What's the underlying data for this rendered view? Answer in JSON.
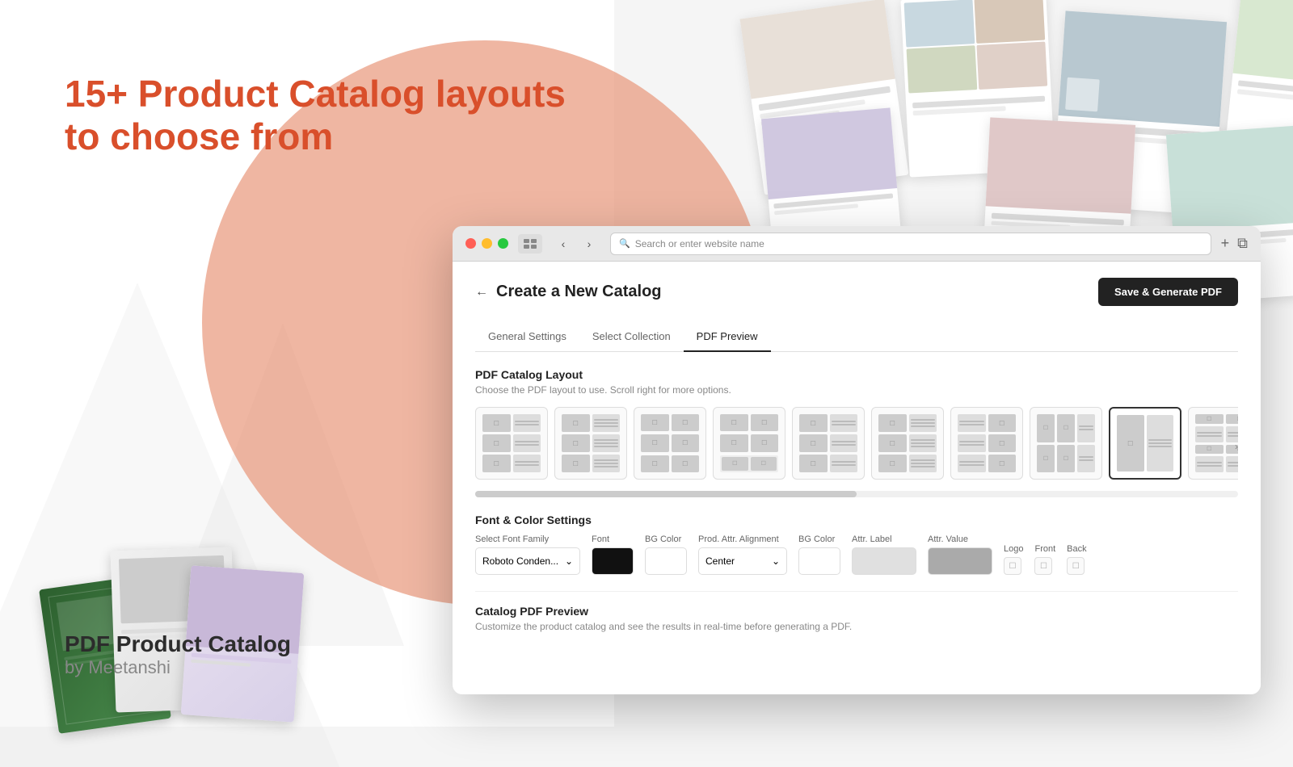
{
  "page": {
    "background": "#f5f5f5"
  },
  "left_panel": {
    "headline_line1": "15+ Product Catalog layouts",
    "headline_line2": "to choose from",
    "brand_title": "PDF Product Catalog",
    "brand_sub": "by Meetanshi"
  },
  "browser": {
    "address_placeholder": "Search or enter website name",
    "title": "Create a New Catalog",
    "save_button": "Save & Generate PDF",
    "back_arrow": "←",
    "tabs": [
      {
        "label": "General Settings",
        "active": false
      },
      {
        "label": "Select Collection",
        "active": false
      },
      {
        "label": "PDF Preview",
        "active": true
      }
    ],
    "layout_section": {
      "title": "PDF Catalog Layout",
      "description": "Choose the PDF layout to use. Scroll right for more options."
    },
    "font_section": {
      "title": "Font & Color Settings",
      "font_family_label": "Select Font Family",
      "font_family_value": "Roboto Conden...",
      "font_label": "Font",
      "bg_color_label": "BG Color",
      "prod_attr_align_label": "Prod. Attr. Alignment",
      "prod_attr_align_value": "Center",
      "bg_color2_label": "BG Color",
      "attr_label_label": "Attr. Label",
      "attr_value_label": "Attr. Value",
      "logo_label": "Logo",
      "front_label": "Front",
      "back_label": "Back"
    },
    "preview_section": {
      "title": "Catalog PDF Preview",
      "description": "Customize the product catalog and see the results in real-time before generating a PDF."
    }
  }
}
